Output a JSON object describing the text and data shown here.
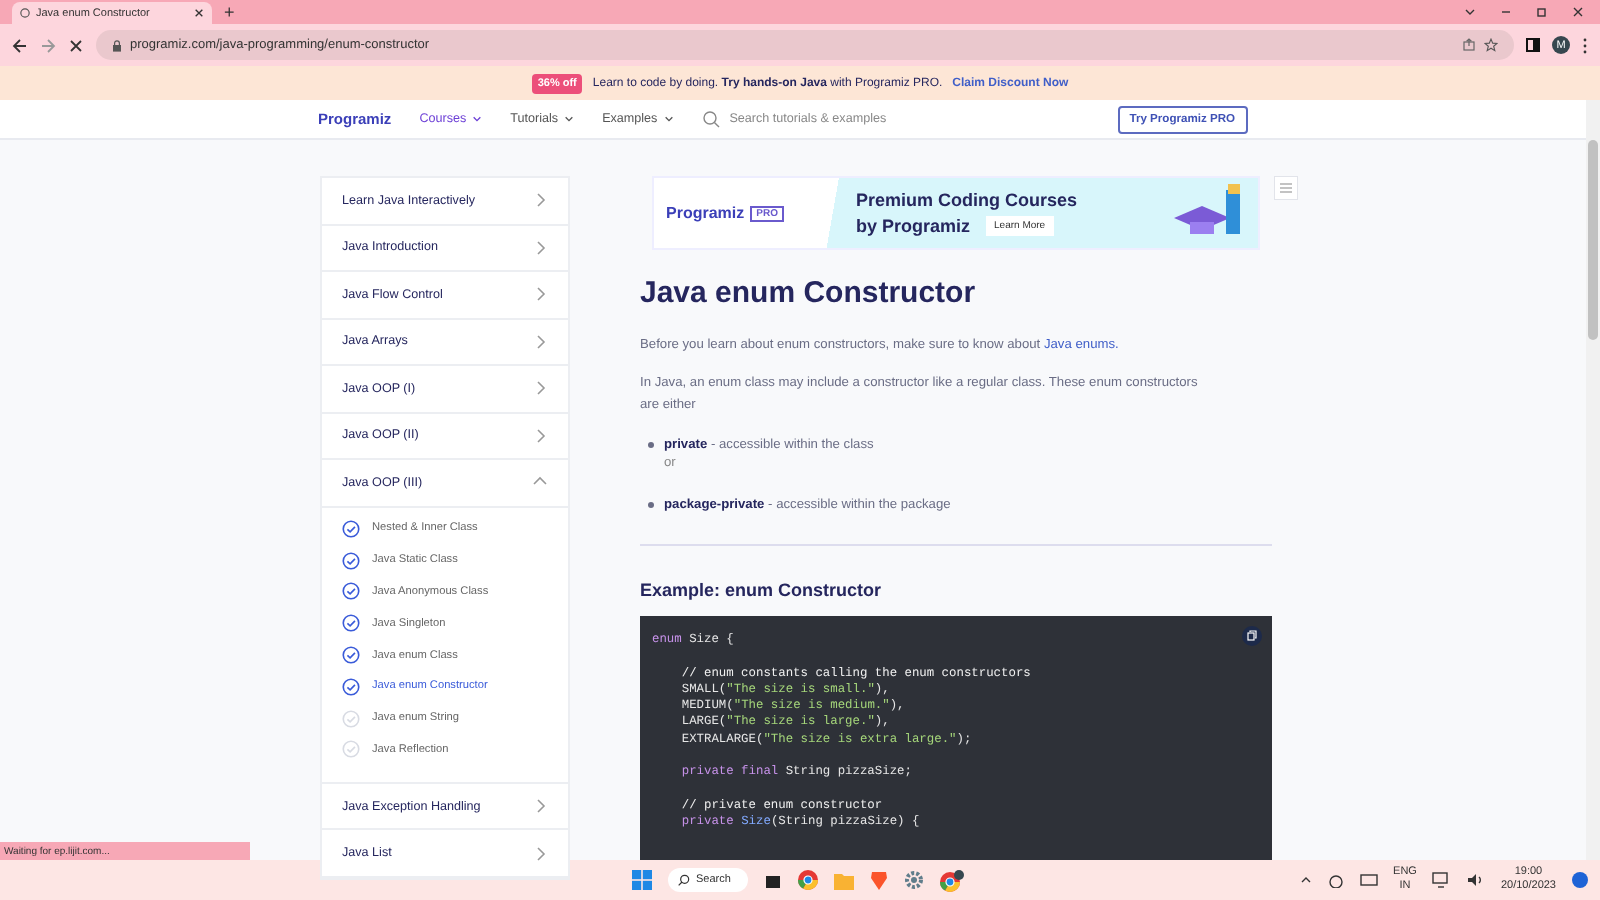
{
  "browser": {
    "tab_title": "Java enum Constructor",
    "new_tab": "+",
    "url": "programiz.com/java-programming/enum-constructor",
    "profile": "M"
  },
  "promo": {
    "badge": "36% off",
    "text": "Learn to code by doing. **Try hands-on Java** with Programiz PRO.",
    "link": "Claim Discount Now"
  },
  "nav": {
    "logo": "Programiz",
    "items": [
      {
        "label": "Courses",
        "selected": true
      },
      {
        "label": "Tutorials",
        "selected": false
      },
      {
        "label": "Examples",
        "selected": false
      }
    ],
    "search": {
      "placeholder": "Search tutorials & examples"
    },
    "button": "Try Programiz PRO"
  },
  "sidebar": {
    "items": [
      {
        "label": "Learn Java Interactively",
        "expanded": false
      },
      {
        "label": "Java Introduction",
        "expanded": false
      },
      {
        "label": "Java Flow Control",
        "expanded": false
      },
      {
        "label": "Java Arrays",
        "expanded": false
      },
      {
        "label": "Java OOP (I)",
        "expanded": false
      },
      {
        "label": "Java OOP (II)",
        "expanded": false
      },
      {
        "label": "Java OOP (III)",
        "expanded": true,
        "children": [
          {
            "label": "Nested & Inner Class",
            "checked": true,
            "selected": false
          },
          {
            "label": "Java Static Class",
            "checked": true,
            "selected": false
          },
          {
            "label": "Java Anonymous Class",
            "checked": true,
            "selected": false
          },
          {
            "label": "Java Singleton",
            "checked": true,
            "selected": false
          },
          {
            "label": "Java enum Class",
            "checked": true,
            "selected": false
          },
          {
            "label": "Java enum Constructor",
            "checked": true,
            "selected": true
          },
          {
            "label": "Java enum String",
            "checked": false,
            "selected": false
          },
          {
            "label": "Java Reflection",
            "checked": false,
            "selected": false
          }
        ]
      },
      {
        "label": "Java Exception Handling",
        "expanded": false
      },
      {
        "label": "Java List",
        "expanded": false
      }
    ]
  },
  "ad": {
    "logo": "Programiz",
    "badge": "PRO",
    "headline": "Premium Coding Courses",
    "subline": "by Programiz",
    "button": "Learn More"
  },
  "article": {
    "title": "Java enum Constructor",
    "intro": "Before you learn about enum constructors, make sure to know about",
    "intro_link": "Java enums.",
    "paragraph": "In Java, an enum class may include a constructor like a regular class. These enum constructors are either",
    "bullets": [
      {
        "term": "private",
        "text": " - accessible within the class"
      },
      {
        "term": "package-private",
        "text": " - accessible within the package"
      }
    ],
    "or": "or",
    "example_title": "Example: enum Constructor",
    "code": [
      {
        "kind": "code",
        "tokens": [
          {
            "kind": "keyword",
            "text": "enum"
          },
          {
            "kind": "plain",
            "text": " Size {"
          }
        ]
      },
      {
        "kind": "blank"
      },
      {
        "kind": "code",
        "tokens": [
          {
            "kind": "comment",
            "text": "    // enum constants calling the enum constructors"
          }
        ]
      },
      {
        "kind": "code",
        "tokens": [
          {
            "kind": "plain",
            "text": "    SMALL("
          },
          {
            "kind": "string",
            "text": "\"The size is small.\""
          },
          {
            "kind": "plain",
            "text": "),"
          }
        ]
      },
      {
        "kind": "code",
        "tokens": [
          {
            "kind": "plain",
            "text": "    MEDIUM("
          },
          {
            "kind": "string",
            "text": "\"The size is medium.\""
          },
          {
            "kind": "plain",
            "text": "),"
          }
        ]
      },
      {
        "kind": "code",
        "tokens": [
          {
            "kind": "plain",
            "text": "    LARGE("
          },
          {
            "kind": "string",
            "text": "\"The size is large.\""
          },
          {
            "kind": "plain",
            "text": "),"
          }
        ]
      },
      {
        "kind": "code",
        "tokens": [
          {
            "kind": "plain",
            "text": "    EXTRALARGE("
          },
          {
            "kind": "string",
            "text": "\"The size is extra large.\""
          },
          {
            "kind": "plain",
            "text": ");"
          }
        ]
      },
      {
        "kind": "blank"
      },
      {
        "kind": "code",
        "tokens": [
          {
            "kind": "keyword",
            "text": "    private final"
          },
          {
            "kind": "plain",
            "text": " String pizzaSize;"
          }
        ]
      },
      {
        "kind": "blank"
      },
      {
        "kind": "code",
        "tokens": [
          {
            "kind": "comment",
            "text": "    // private enum constructor"
          }
        ]
      },
      {
        "kind": "code",
        "tokens": [
          {
            "kind": "keyword",
            "text": "    private"
          },
          {
            "kind": "function",
            "text": " Size"
          },
          {
            "kind": "plain",
            "text": "(String pizzaSize) {"
          }
        ]
      }
    ]
  },
  "status": "Waiting for ep.lijit.com...",
  "taskbar": {
    "search": "Search",
    "language": "ENG",
    "region": "IN",
    "time": "19:00",
    "date": "20/10/2023"
  }
}
